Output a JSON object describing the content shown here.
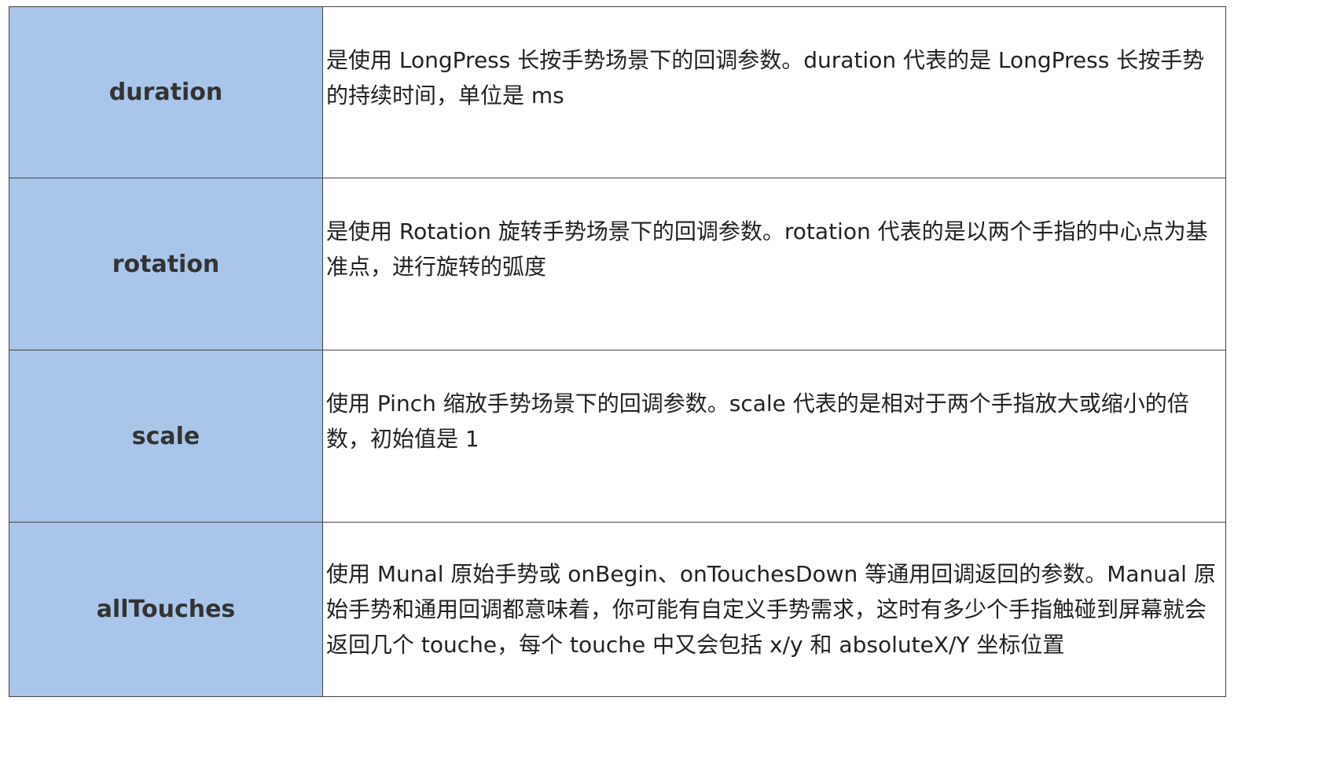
{
  "rows": [
    {
      "name": "duration",
      "description": "是使用 LongPress 长按手势场景下的回调参数。duration 代表的是 LongPress 长按手势的持续时间，单位是 ms"
    },
    {
      "name": "rotation",
      "description": "是使用 Rotation 旋转手势场景下的回调参数。rotation 代表的是以两个手指的中心点为基准点，进行旋转的弧度"
    },
    {
      "name": "scale",
      "description": "使用 Pinch 缩放手势场景下的回调参数。scale 代表的是相对于两个手指放大或缩小的倍数，初始值是 1"
    },
    {
      "name": "allTouches",
      "description": "使用 Munal 原始手势或 onBegin、onTouchesDown 等通用回调返回的参数。Manual 原始手势和通用回调都意味着，你可能有自定义手势需求，这时有多少个手指触碰到屏幕就会返回几个 touche，每个 touche 中又会包括 x/y 和 absoluteX/Y 坐标位置"
    }
  ]
}
